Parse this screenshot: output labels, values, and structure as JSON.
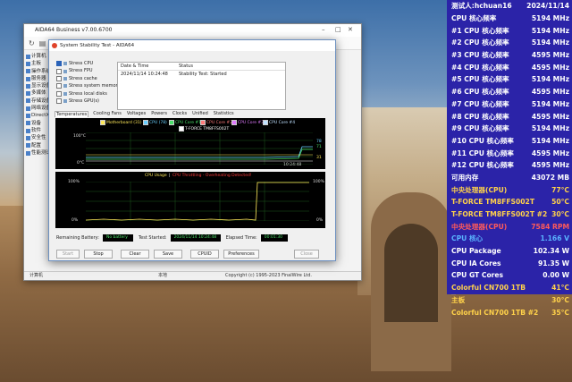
{
  "main_window": {
    "title": "AIDA64 Business v7.00.6700",
    "tree": [
      "计算机",
      "主板",
      "操作系统",
      "服务器",
      "显示设备",
      "多媒体",
      "存储设备",
      "网络设备",
      "DirectX",
      "设备",
      "软件",
      "安全性",
      "配置",
      "性能测试"
    ],
    "status_left": "计算机",
    "status_mid": "本地",
    "status_right": "Copyright (c) 1995-2023 FinalWire Ltd."
  },
  "stability": {
    "title": "System Stability Test - AIDA64",
    "checks": [
      {
        "label": "Stress CPU",
        "checked": true
      },
      {
        "label": "Stress FPU",
        "checked": false
      },
      {
        "label": "Stress cache",
        "checked": false
      },
      {
        "label": "Stress system memory",
        "checked": false
      },
      {
        "label": "Stress local disks",
        "checked": false
      },
      {
        "label": "Stress GPU(s)",
        "checked": false
      }
    ],
    "log_headers": {
      "date": "Date & Time",
      "status": "Status"
    },
    "log_rows": [
      {
        "date": "2024/11/14 10:24:48",
        "status": "Stability Test: Started"
      }
    ],
    "tabs": [
      "Temperatures",
      "Cooling Fans",
      "Voltages",
      "Powers",
      "Clocks",
      "Unified",
      "Statistics"
    ],
    "graph1": {
      "legend": [
        "Motherboard (31)",
        "CPU (78)",
        "CPU Core #1",
        "CPU Core #2",
        "CPU Core #3",
        "CPU Core #4",
        "T-FORCE TM8FFS002T"
      ],
      "top_label": "100°C",
      "bottom_label": "0°C",
      "time": "10:24:48",
      "right_vals": [
        "78",
        "71",
        "31"
      ]
    },
    "graph2": {
      "title_usage": "CPU Usage",
      "title_throttle": "CPU Throttling - Overheating Detected!",
      "top_left": "100%",
      "bottom_left": "0%",
      "top_right": "100%",
      "bottom_right": "0%"
    },
    "remaining_battery_label": "Remaining Battery:",
    "remaining_battery": "No battery",
    "test_started_label": "Test Started:",
    "test_started": "2024/11/14 10:24:48",
    "elapsed_label": "Elapsed Time:",
    "elapsed": "00:01:30",
    "buttons": {
      "start": "Start",
      "stop": "Stop",
      "clear": "Clear",
      "save": "Save",
      "cpuid": "CPUID",
      "preferences": "Preferences",
      "close": "Close"
    }
  },
  "osd": {
    "header_user": "测试人:hchuan16",
    "header_date": "2024/11/14",
    "rows": [
      {
        "k": "CPU 核心频率",
        "v": "5194 MHz",
        "color": "#ffffff"
      },
      {
        "k": "#1 CPU 核心频率",
        "v": "5194 MHz",
        "color": "#ffffff"
      },
      {
        "k": "#2 CPU 核心频率",
        "v": "5194 MHz",
        "color": "#ffffff"
      },
      {
        "k": "#3 CPU 核心频率",
        "v": "4595 MHz",
        "color": "#ffffff"
      },
      {
        "k": "#4 CPU 核心频率",
        "v": "4595 MHz",
        "color": "#ffffff"
      },
      {
        "k": "#5 CPU 核心频率",
        "v": "5194 MHz",
        "color": "#ffffff"
      },
      {
        "k": "#6 CPU 核心频率",
        "v": "4595 MHz",
        "color": "#ffffff"
      },
      {
        "k": "#7 CPU 核心频率",
        "v": "5194 MHz",
        "color": "#ffffff"
      },
      {
        "k": "#8 CPU 核心频率",
        "v": "4595 MHz",
        "color": "#ffffff"
      },
      {
        "k": "#9 CPU 核心频率",
        "v": "5194 MHz",
        "color": "#ffffff"
      },
      {
        "k": "#10 CPU 核心频率",
        "v": "5194 MHz",
        "color": "#ffffff"
      },
      {
        "k": "#11 CPU 核心频率",
        "v": "4595 MHz",
        "color": "#ffffff"
      },
      {
        "k": "#12 CPU 核心频率",
        "v": "4595 MHz",
        "color": "#ffffff"
      },
      {
        "k": "可用内存",
        "v": "43072 MB",
        "color": "#ffffff"
      },
      {
        "k": "中央处理器(CPU)",
        "v": "77°C",
        "color": "#ffd24a"
      },
      {
        "k": "T-FORCE TM8FFS002T",
        "v": "50°C",
        "color": "#ffd24a"
      },
      {
        "k": "T-FORCE TM8FFS002T #2",
        "v": "30°C",
        "color": "#ffd24a"
      },
      {
        "k": "中央处理器(CPU)",
        "v": "7584 RPM",
        "color": "#ff5a5a"
      },
      {
        "k": "CPU 核心",
        "v": "1.166 V",
        "color": "#5ab4ff"
      },
      {
        "k": "CPU Package",
        "v": "102.34 W",
        "color": "#ffffff"
      },
      {
        "k": "CPU IA Cores",
        "v": "91.35 W",
        "color": "#ffffff"
      },
      {
        "k": "CPU GT Cores",
        "v": "0.00 W",
        "color": "#ffffff"
      },
      {
        "k": "Colorful CN700 1TB",
        "v": "41°C",
        "color": "#ffd24a"
      },
      {
        "k": "主板",
        "v": "30°C",
        "color": "#ffd24a"
      },
      {
        "k": "Colorful CN700 1TB #2",
        "v": "35°C",
        "color": "#ffd24a"
      }
    ]
  }
}
